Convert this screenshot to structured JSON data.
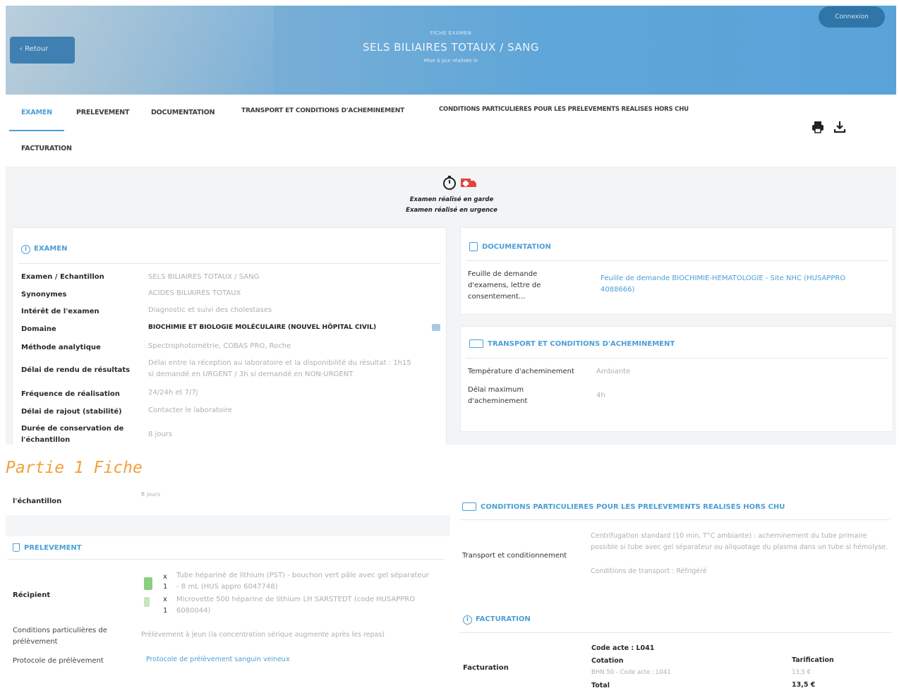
{
  "header": {
    "back_label": "Retour",
    "login_label": "Connexion",
    "overline": "FICHE EXAMEN",
    "title": "SELS BILIAIRES TOTAUX / SANG",
    "subline": "Mise à jour réalisée le"
  },
  "tabs": [
    {
      "label": "EXAMEN"
    },
    {
      "label": "PRELEVEMENT"
    },
    {
      "label": "DOCUMENTATION"
    },
    {
      "label": "TRANSPORT ET CONDITIONS D'ACHEMINEMENT"
    },
    {
      "label": "CONDITIONS PARTICULIERES POUR LES PRELEVEMENTS REALISES HORS CHU"
    },
    {
      "label": "FACTURATION"
    }
  ],
  "badges": {
    "line1": "Examen réalisé en garde",
    "line2": "Examen réalisé en urgence"
  },
  "examen": {
    "heading": "EXAMEN",
    "rows": [
      {
        "label": "Examen / Echantillon",
        "value": "SELS BILIAIRES TOTAUX / SANG"
      },
      {
        "label": "Synonymes",
        "value": "ACIDES BILIAIRES TOTAUX"
      },
      {
        "label": "Intérêt de l'examen",
        "value": "Diagnostic et suivi des cholestases"
      },
      {
        "label": "Domaine",
        "value": "BIOCHIMIE ET BIOLOGIE MOLÉCULAIRE (NOUVEL HÔPITAL CIVIL)"
      },
      {
        "label": "Méthode analytique",
        "value": "Spectrophotométrie, COBAS PRO, Roche"
      },
      {
        "label": "Délai de rendu de résultats",
        "value": "Délai entre la réception au laboratoire et la disponibilité du résultat : 1h15 si demandé en URGENT / 3h si demandé en NON-URGENT"
      },
      {
        "label": "Fréquence de réalisation",
        "value": "24/24h et 7/7j"
      },
      {
        "label": "Délai de rajout (stabilité)",
        "value": "Contacter le laboratoire"
      },
      {
        "label": "Durée de conservation de l'échantillon",
        "value": "8 jours"
      }
    ]
  },
  "watermark": {
    "part_label": "Partie 1 Fiche"
  },
  "continued": {
    "label": "l'échantillon",
    "value": "8 jours"
  },
  "prelevement": {
    "heading": "PRELEVEMENT",
    "recipient_label": "Récipient",
    "recipient_item1_qty": "1",
    "recipient_item1_x": "x",
    "recipient_item1_text": "Tube hépariné de lithium (PST) - bouchon vert pâle avec gel séparateur - 8 mL (HUS appro 6047748)",
    "recipient_item2_qty": "1",
    "recipient_item2_x": "x",
    "recipient_item2_text": "Microvette 500 héparine de lithium LH SARSTEDT (code HUSAPPRO 6080044)",
    "conditions_label": "Conditions particulières de prélèvement",
    "conditions_value": "Prélèvement à jeun (la concentration sérique augmente après les repas)",
    "protocol_label": "Protocole de prélèvement",
    "protocol_link": "Protocole de prélèvement sanguin veineux"
  },
  "documentation": {
    "heading": "DOCUMENTATION",
    "label": "Feuille de demande d'examens, lettre de consentement...",
    "link": "Feuille de demande BIOCHIMIE-HEMATOLOGIE - Site NHC (HUSAPPRO 4088666)"
  },
  "transport": {
    "heading": "TRANSPORT ET CONDITIONS D'ACHEMINEMENT",
    "temp_label": "Température d'acheminement",
    "temp_value": "Ambiante",
    "delay_label": "Délai maximum d'acheminement",
    "delay_value": "4h"
  },
  "hors_chu": {
    "heading": "CONDITIONS PARTICULIERES POUR LES PRELEVEMENTS REALISES HORS CHU",
    "label": "Transport et conditionnement",
    "value1": "Centrifugation standard (10 min, T°C ambiante) : acheminement du tube primaire possible si tube avec gel séparateur ou aliquotage du plasma dans un tube si hémolyse.",
    "value2": "Conditions de transport : Réfrigéré"
  },
  "facturation": {
    "heading": "FACTURATION",
    "label": "Facturation",
    "code_acte": "Code acte : L041",
    "cotation": "Cotation",
    "cotation_detail": "BHN 50 - Code acte : L041",
    "total": "Total",
    "tarif_label": "Tarification",
    "tarif_value": "13,5 €",
    "tarif_total": "13,5 €"
  },
  "colors": {
    "accent": "#4a9fd6",
    "header_bg": "#5fa6d8",
    "watermark": "#e3e6e8",
    "part_label": "#f0a13c",
    "red_icon": "#e0463e"
  }
}
